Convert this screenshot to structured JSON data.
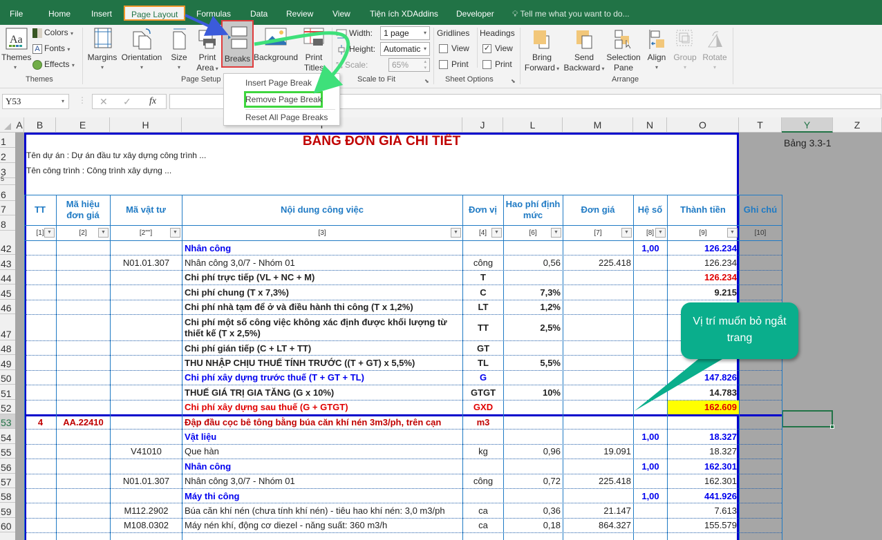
{
  "menu_tabs": [
    {
      "label": "File"
    },
    {
      "label": "Home"
    },
    {
      "label": "Insert"
    },
    {
      "label": "Page Layout"
    },
    {
      "label": "Formulas"
    },
    {
      "label": "Data"
    },
    {
      "label": "Review"
    },
    {
      "label": "View"
    },
    {
      "label": "Tiện ích XDAddins"
    },
    {
      "label": "Developer"
    }
  ],
  "tell_me": "Tell me what you want to do...",
  "ribbon": {
    "themes": {
      "themes": "Themes",
      "colors": "Colors",
      "fonts": "Fonts",
      "effects": "Effects",
      "group": "Themes"
    },
    "page_setup": {
      "margins": "Margins",
      "orientation": "Orientation",
      "size": "Size",
      "print_area_1": "Print",
      "print_area_2": "Area",
      "breaks": "Breaks",
      "background": "Background",
      "print_titles_1": "Print",
      "print_titles_2": "Titles",
      "group": "Page Setup"
    },
    "scale_to_fit": {
      "width_label": "Width:",
      "width_value": "1 page",
      "height_label": "Height:",
      "height_value": "Automatic",
      "scale_label": "Scale:",
      "scale_value": "65%",
      "group": "Scale to Fit"
    },
    "sheet_options": {
      "gridlines": "Gridlines",
      "headings": "Headings",
      "view": "View",
      "print": "Print",
      "group": "Sheet Options",
      "gridlines_view": false,
      "gridlines_print": false,
      "headings_view": true,
      "headings_print": false
    },
    "arrange": {
      "bring_1": "Bring",
      "bring_2": "Forward",
      "send_1": "Send",
      "send_2": "Backward",
      "selection_1": "Selection",
      "selection_2": "Pane",
      "align": "Align",
      "group_btn": "Group",
      "rotate": "Rotate",
      "group": "Arrange"
    }
  },
  "breaks_menu": [
    {
      "label": "Insert Page Break",
      "highlighted": false
    },
    {
      "label": "Remove Page Break",
      "highlighted": true
    },
    {
      "label": "Reset All Page Breaks",
      "highlighted": false
    }
  ],
  "name_box": "Y53",
  "formula_value": "",
  "column_headers": [
    "A",
    "B",
    "E",
    "H",
    "I",
    "J",
    "L",
    "M",
    "N",
    "O",
    "T",
    "Y",
    "Z"
  ],
  "selected_column": "Y",
  "sheet": {
    "title": "BẢNG ĐƠN GIÁ CHI TIẾT",
    "ref": "Bảng 3.3-1",
    "project": "Tên dự án : Dự án đầu tư xây dựng công trình ...",
    "work": "Tên công trình : Công trình xây dựng ...",
    "headers": [
      "TT",
      "Mã hiệu đơn giá",
      "Mã vật tư",
      "Nội dung công việc",
      "Đơn vị",
      "Hao phí định mức",
      "Đơn giá",
      "Hệ số",
      "Thành tiền",
      "Ghi chú"
    ],
    "header_codes": [
      "[1]",
      "[2]",
      "[2\"\"]",
      "[3]",
      "[4]",
      "[6]",
      "[7]",
      "[8]",
      "[9]",
      "[10]"
    ],
    "rows": [
      {
        "row": "42",
        "tt": "",
        "code": "",
        "mat": "",
        "desc": "Nhân công",
        "unit": "",
        "qty": "",
        "price": "",
        "coef": "1,00",
        "total": "126.234",
        "style": "section"
      },
      {
        "row": "43",
        "tt": "",
        "code": "",
        "mat": "N01.01.307",
        "desc": "Nhân công 3,0/7 - Nhóm 01",
        "unit": "công",
        "qty": "0,56",
        "price": "225.418",
        "coef": "",
        "total": "126.234",
        "style": "normal"
      },
      {
        "row": "44",
        "tt": "",
        "code": "",
        "mat": "",
        "desc": "Chi phí trực tiếp (VL + NC + M)",
        "unit": "T",
        "qty": "",
        "price": "",
        "coef": "",
        "total": "126.234",
        "style": "bold-redtotal"
      },
      {
        "row": "45",
        "tt": "",
        "code": "",
        "mat": "",
        "desc": "Chi phí chung (T x 7,3%)",
        "unit": "C",
        "qty": "7,3%",
        "price": "",
        "coef": "",
        "total": "9.215",
        "style": "bold"
      },
      {
        "row": "46",
        "tt": "",
        "code": "",
        "mat": "",
        "desc": "Chi phí nhà tạm để ở và điều hành thi công (T x 1,2%)",
        "unit": "LT",
        "qty": "1,2%",
        "price": "",
        "coef": "",
        "total": "",
        "style": "bold"
      },
      {
        "row": "47",
        "tt": "",
        "code": "",
        "mat": "",
        "desc": "Chi phí một số công việc không xác định được khối lượng từ thiết kế (T x 2,5%)",
        "unit": "TT",
        "qty": "2,5%",
        "price": "",
        "coef": "",
        "total": "",
        "style": "bold-tall"
      },
      {
        "row": "48",
        "tt": "",
        "code": "",
        "mat": "",
        "desc": "Chi phí gián tiếp (C + LT + TT)",
        "unit": "GT",
        "qty": "",
        "price": "",
        "coef": "",
        "total": "",
        "style": "bold"
      },
      {
        "row": "49",
        "tt": "",
        "code": "",
        "mat": "",
        "desc": "THU NHẬP CHỊU THUẾ TÍNH TRƯỚC ((T + GT) x 5,5%)",
        "unit": "TL",
        "qty": "5,5%",
        "price": "",
        "coef": "",
        "total": "",
        "style": "bold"
      },
      {
        "row": "50",
        "tt": "",
        "code": "",
        "mat": "",
        "desc": "Chi phí xây dựng trước thuế (T + GT + TL)",
        "unit": "G",
        "qty": "",
        "price": "",
        "coef": "",
        "total": "147.826",
        "style": "blue"
      },
      {
        "row": "51",
        "tt": "",
        "code": "",
        "mat": "",
        "desc": "THUẾ GIÁ TRỊ GIA TĂNG (G x 10%)",
        "unit": "GTGT",
        "qty": "10%",
        "price": "",
        "coef": "",
        "total": "14.783",
        "style": "bold"
      },
      {
        "row": "52",
        "tt": "",
        "code": "",
        "mat": "",
        "desc": "Chi phí xây dựng sau thuế (G + GTGT)",
        "unit": "GXD",
        "qty": "",
        "price": "",
        "coef": "",
        "total": "162.609",
        "style": "red-yellow"
      },
      {
        "row": "53",
        "tt": "4",
        "code": "AA.22410",
        "mat": "",
        "desc": "Đập đầu cọc bê tông bằng búa căn khí nén 3m3/ph, trên cạn",
        "unit": "m3",
        "qty": "",
        "price": "",
        "coef": "",
        "total": "",
        "style": "task"
      },
      {
        "row": "54",
        "tt": "",
        "code": "",
        "mat": "",
        "desc": "Vật liệu",
        "unit": "",
        "qty": "",
        "price": "",
        "coef": "1,00",
        "total": "18.327",
        "style": "section"
      },
      {
        "row": "55",
        "tt": "",
        "code": "",
        "mat": "V41010",
        "desc": "Que hàn",
        "unit": "kg",
        "qty": "0,96",
        "price": "19.091",
        "coef": "",
        "total": "18.327",
        "style": "normal"
      },
      {
        "row": "56",
        "tt": "",
        "code": "",
        "mat": "",
        "desc": "Nhân công",
        "unit": "",
        "qty": "",
        "price": "",
        "coef": "1,00",
        "total": "162.301",
        "style": "section"
      },
      {
        "row": "57",
        "tt": "",
        "code": "",
        "mat": "N01.01.307",
        "desc": "Nhân công 3,0/7 - Nhóm 01",
        "unit": "công",
        "qty": "0,72",
        "price": "225.418",
        "coef": "",
        "total": "162.301",
        "style": "normal"
      },
      {
        "row": "58",
        "tt": "",
        "code": "",
        "mat": "",
        "desc": "Máy thi công",
        "unit": "",
        "qty": "",
        "price": "",
        "coef": "1,00",
        "total": "441.926",
        "style": "section"
      },
      {
        "row": "59",
        "tt": "",
        "code": "",
        "mat": "M112.2902",
        "desc": "Búa căn khí nén (chưa tính khí nén) - tiêu hao khí nén: 3,0 m3/ph",
        "unit": "ca",
        "qty": "0,36",
        "price": "21.147",
        "coef": "",
        "total": "7.613",
        "style": "normal"
      },
      {
        "row": "60",
        "tt": "",
        "code": "",
        "mat": "M108.0302",
        "desc": "Máy nén khí, động cơ diezel - năng suất: 360 m3/h",
        "unit": "ca",
        "qty": "0,18",
        "price": "864.327",
        "coef": "",
        "total": "155.579",
        "style": "normal"
      }
    ]
  },
  "callout": "Vị trí muốn bỏ ngắt trang",
  "colors": {
    "accent": "#217346",
    "page_break": "#0000cc",
    "header_blue": "#1f7ac4",
    "highlight": "#ffff00",
    "callout": "#0aae8c",
    "arrow_blue": "#3b5bdb",
    "arrow_green": "#3ee07a"
  }
}
